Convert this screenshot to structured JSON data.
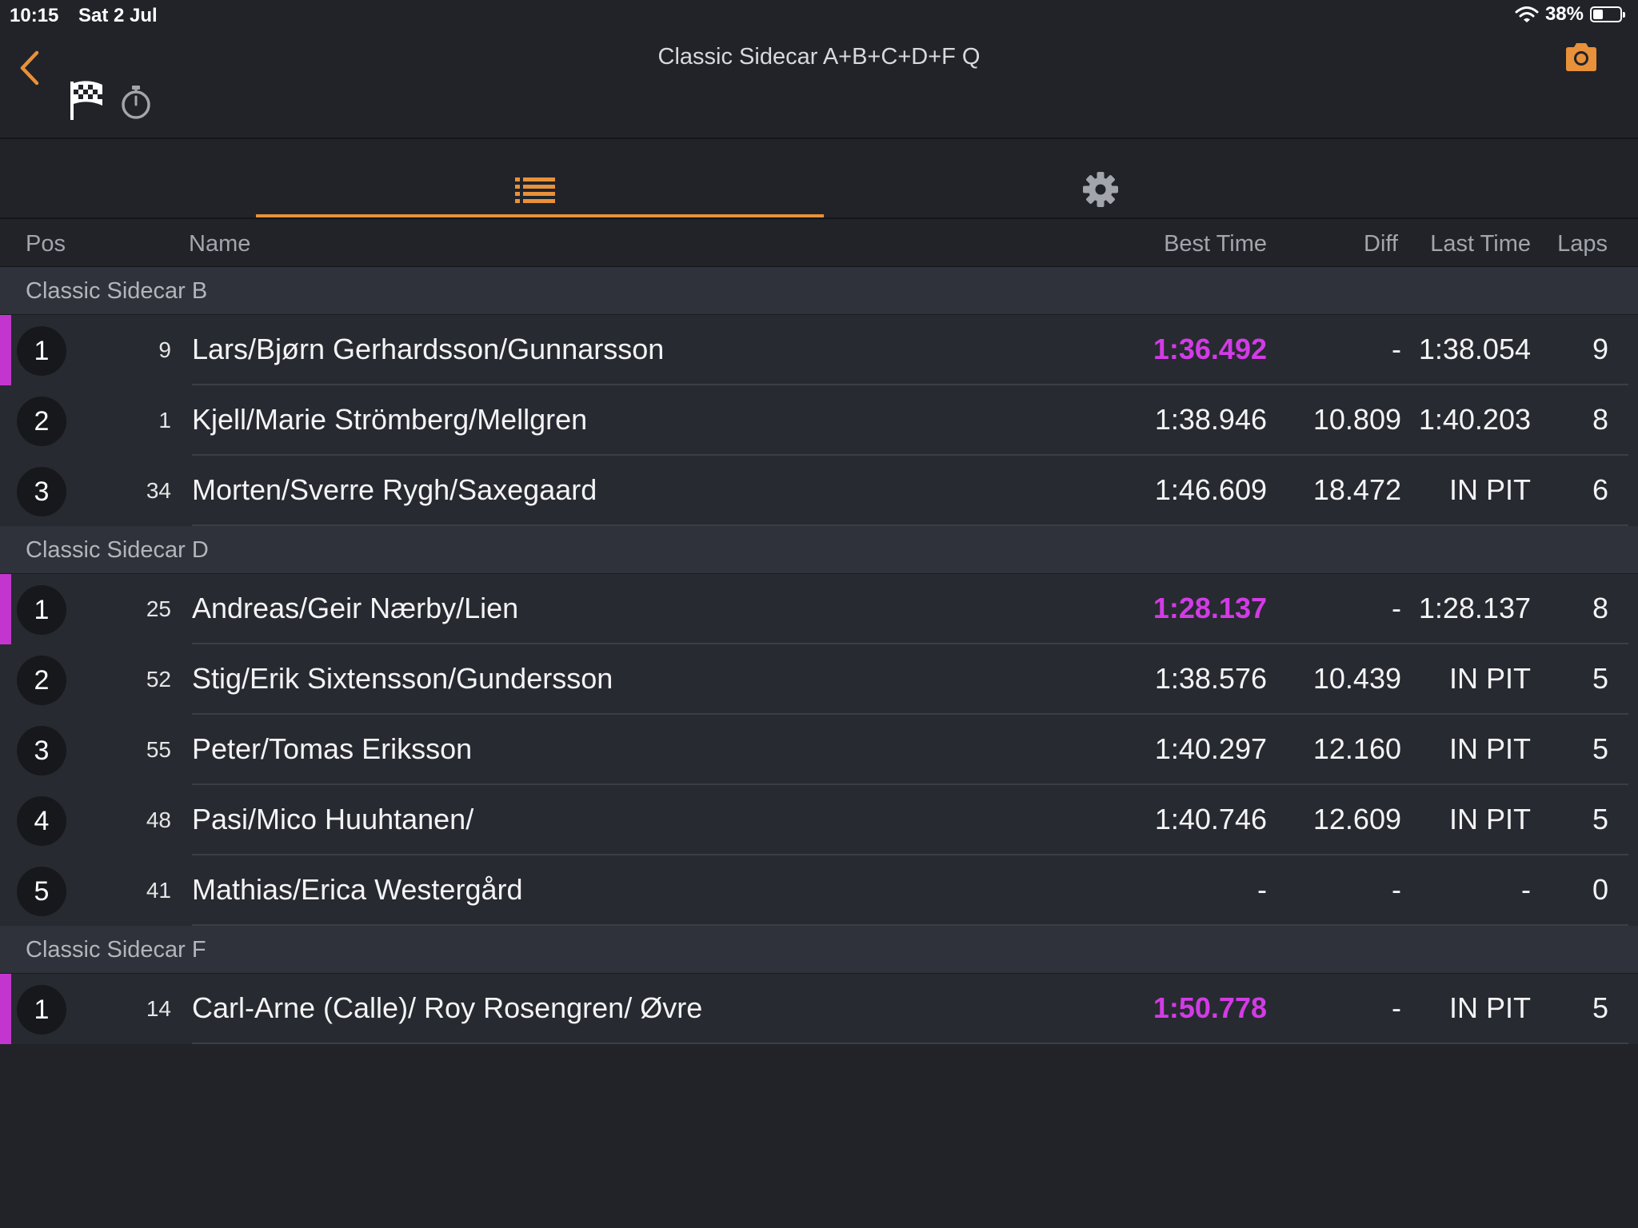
{
  "status_bar": {
    "time": "10:15",
    "date": "Sat 2 Jul",
    "battery": "38%"
  },
  "header": {
    "title": "Classic Sidecar A+B+C+D+F Q"
  },
  "columns": {
    "pos": "Pos",
    "name": "Name",
    "best": "Best Time",
    "diff": "Diff",
    "last": "Last Time",
    "laps": "Laps"
  },
  "colors": {
    "accent": "#e8913a",
    "fastest": "#d23be6",
    "background": "#212329"
  },
  "icons": {
    "back": "chevron-left-icon",
    "flag": "checkered-flag-icon",
    "timer": "stopwatch-icon",
    "camera": "camera-icon",
    "list": "list-icon",
    "settings": "gear-icon",
    "wifi": "wifi-icon",
    "battery": "battery-icon"
  },
  "sections": [
    {
      "title": "Classic Sidecar B",
      "rows": [
        {
          "pos": "1",
          "num": "9",
          "name": "Lars/Bjørn Gerhardsson/Gunnarsson",
          "best": "1:36.492",
          "diff": "-",
          "last": "1:38.054",
          "laps": "9",
          "fastest": true
        },
        {
          "pos": "2",
          "num": "1",
          "name": "Kjell/Marie Strömberg/Mellgren",
          "best": "1:38.946",
          "diff": "10.809",
          "last": "1:40.203",
          "laps": "8",
          "fastest": false
        },
        {
          "pos": "3",
          "num": "34",
          "name": "Morten/Sverre Rygh/Saxegaard",
          "best": "1:46.609",
          "diff": "18.472",
          "last": "IN PIT",
          "laps": "6",
          "fastest": false
        }
      ]
    },
    {
      "title": "Classic Sidecar D",
      "rows": [
        {
          "pos": "1",
          "num": "25",
          "name": "Andreas/Geir Nærby/Lien",
          "best": "1:28.137",
          "diff": "-",
          "last": "1:28.137",
          "laps": "8",
          "fastest": true
        },
        {
          "pos": "2",
          "num": "52",
          "name": "Stig/Erik Sixtensson/Gundersson",
          "best": "1:38.576",
          "diff": "10.439",
          "last": "IN PIT",
          "laps": "5",
          "fastest": false
        },
        {
          "pos": "3",
          "num": "55",
          "name": "Peter/Tomas Eriksson",
          "best": "1:40.297",
          "diff": "12.160",
          "last": "IN PIT",
          "laps": "5",
          "fastest": false
        },
        {
          "pos": "4",
          "num": "48",
          "name": "Pasi/Mico Huuhtanen/",
          "best": "1:40.746",
          "diff": "12.609",
          "last": "IN PIT",
          "laps": "5",
          "fastest": false
        },
        {
          "pos": "5",
          "num": "41",
          "name": "Mathias/Erica Westergård",
          "best": "-",
          "diff": "-",
          "last": "-",
          "laps": "0",
          "fastest": false
        }
      ]
    },
    {
      "title": "Classic Sidecar F",
      "rows": [
        {
          "pos": "1",
          "num": "14",
          "name": "Carl-Arne (Calle)/ Roy Rosengren/ Øvre",
          "best": "1:50.778",
          "diff": "-",
          "last": "IN PIT",
          "laps": "5",
          "fastest": true
        }
      ]
    }
  ]
}
